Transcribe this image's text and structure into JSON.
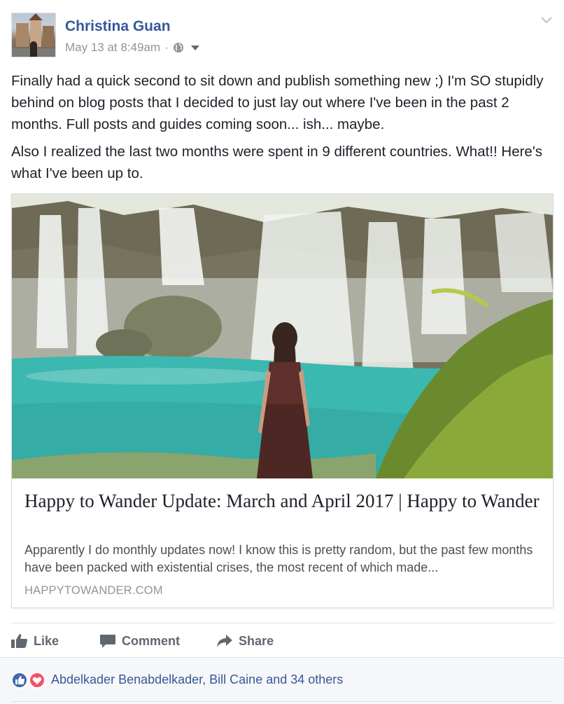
{
  "post": {
    "author": "Christina Guan",
    "timestamp": "May 13 at 8:49am",
    "separator": "·",
    "audience_icon": "globe-icon",
    "options_icon": "chevron-down-icon",
    "paragraphs": [
      "Finally had a quick second to sit down and publish something new ;) I'm SO stupidly behind on blog posts that I decided to just lay out where I've been in the past 2 months. Full posts and guides coming soon... ish... maybe.",
      "Also I realized the last two months were spent in 9 different countries. What!! Here's what I've been up to."
    ]
  },
  "link": {
    "title": "Happy to Wander Update: March and April 2017 | Happy to Wander",
    "description": "Apparently I do monthly updates now! I know this is pretty random, but the past few months have been packed with existential crises, the most recent of which made...",
    "domain": "HAPPYTOWANDER.COM"
  },
  "actions": {
    "like": "Like",
    "comment": "Comment",
    "share": "Share"
  },
  "reactions": {
    "icons": [
      "like-reaction-icon",
      "love-reaction-icon"
    ],
    "text": "Abdelkader Benabdelkader, Bill Caine and 34 others"
  },
  "colors": {
    "link_blue": "#365899",
    "meta_gray": "#90949c",
    "action_gray": "#606770",
    "like_blue": "#4267b2",
    "love_red": "#f25268"
  }
}
